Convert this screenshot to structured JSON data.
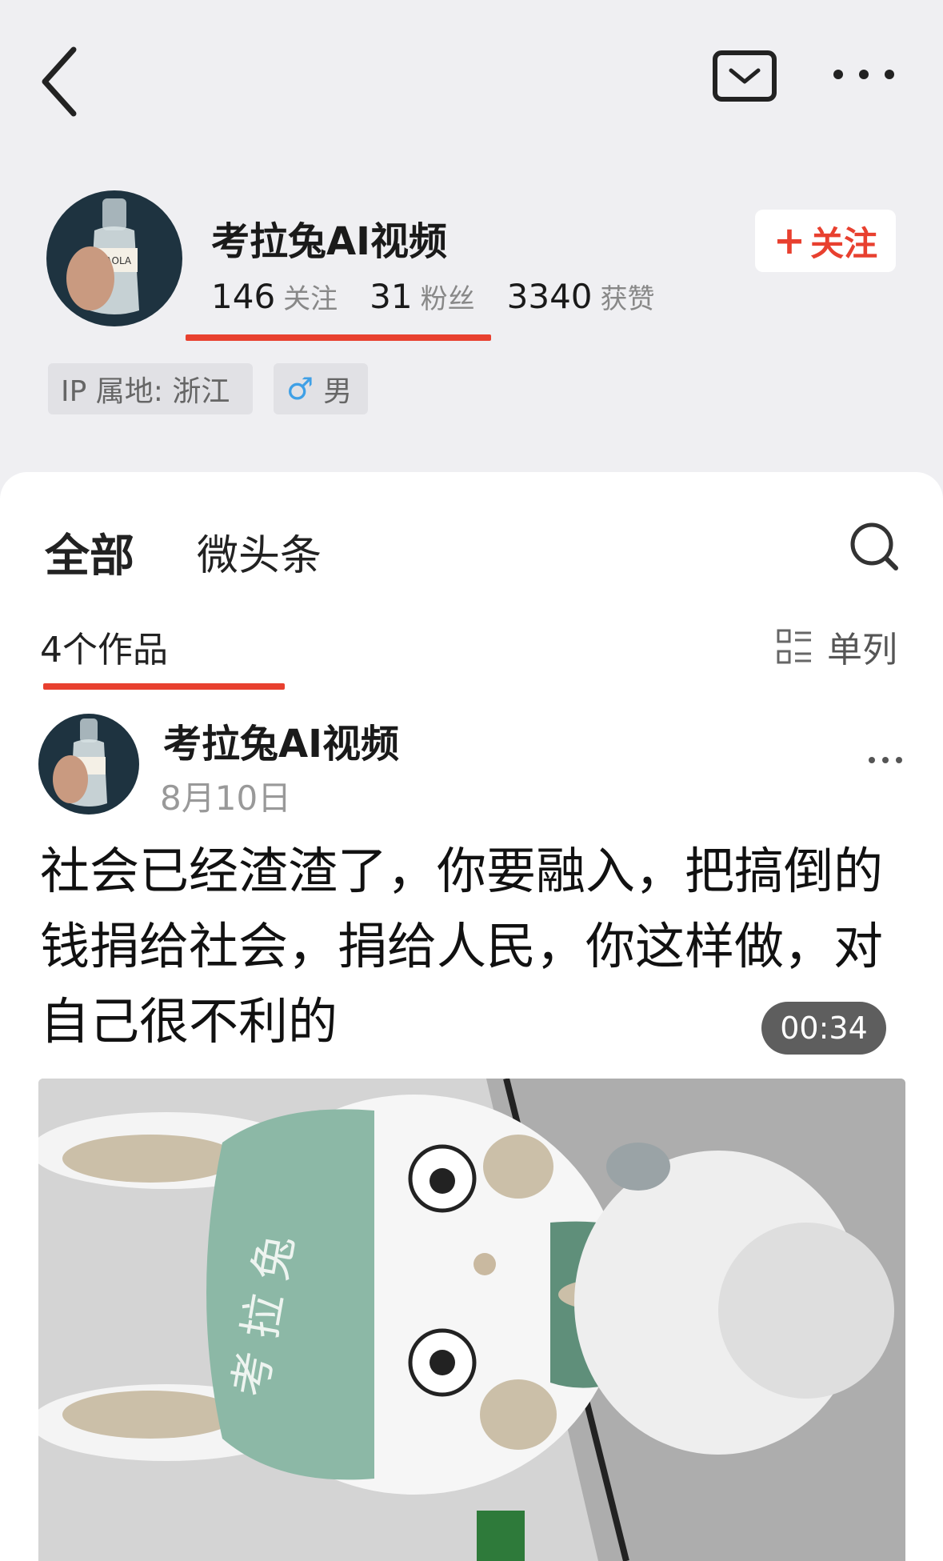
{
  "profile": {
    "name": "考拉兔AI视频",
    "follow_button": "关注",
    "stats": [
      {
        "value": "146",
        "label": "关注"
      },
      {
        "value": "31",
        "label": "粉丝"
      },
      {
        "value": "3340",
        "label": "获赞"
      }
    ],
    "ip_tag": "IP 属地: 浙江",
    "gender_tag": "男",
    "avatar_bottle_text": "KAOLA"
  },
  "tabs": {
    "all": "全部",
    "weitoutiao": "微头条"
  },
  "works": {
    "count_label": "4个作品",
    "view_mode": "单列"
  },
  "post": {
    "author": "考拉兔AI视频",
    "date": "8月10日",
    "text": "社会已经渣渣了，你要融入，把搞倒的钱捐给社会，捐给人民，你这样做，对自己很不利的",
    "duration": "00:34",
    "thumb_text": "考 拉 兔"
  },
  "colors": {
    "accent": "#e8402f",
    "page_bg": "#efeff2",
    "gender_blue": "#3fa0e6"
  },
  "icons": [
    "back-arrow-icon",
    "message-envelope-icon",
    "more-dots-icon",
    "plus-icon",
    "male-icon",
    "search-icon",
    "list-view-icon",
    "play-icon"
  ]
}
